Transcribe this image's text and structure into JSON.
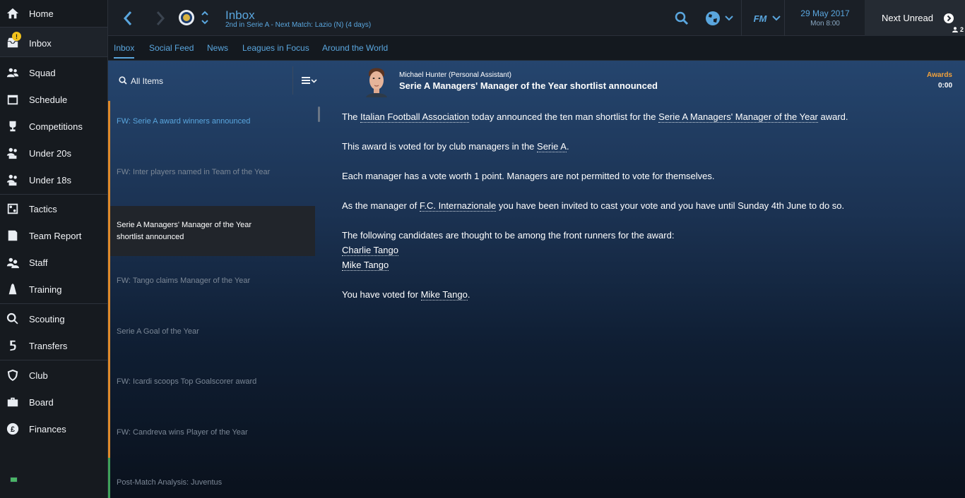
{
  "sidebar": {
    "items": [
      {
        "label": "Home",
        "icon": "home-icon"
      },
      {
        "label": "Inbox",
        "icon": "inbox-icon",
        "badge": "!"
      },
      {
        "label": "Squad",
        "icon": "squad-icon"
      },
      {
        "label": "Schedule",
        "icon": "schedule-icon"
      },
      {
        "label": "Competitions",
        "icon": "trophy-icon"
      },
      {
        "label": "Under 20s",
        "icon": "under20s-icon"
      },
      {
        "label": "Under 18s",
        "icon": "under18s-icon"
      },
      {
        "label": "Tactics",
        "icon": "tactics-icon"
      },
      {
        "label": "Team Report",
        "icon": "team-report-icon"
      },
      {
        "label": "Staff",
        "icon": "staff-icon"
      },
      {
        "label": "Training",
        "icon": "training-icon"
      },
      {
        "label": "Scouting",
        "icon": "scouting-icon"
      },
      {
        "label": "Transfers",
        "icon": "transfers-icon"
      },
      {
        "label": "Club",
        "icon": "club-shield-icon"
      },
      {
        "label": "Board",
        "icon": "briefcase-icon"
      },
      {
        "label": "Finances",
        "icon": "pound-coin-icon"
      }
    ]
  },
  "header": {
    "title": "Inbox",
    "subtitle": "2nd in Serie A - Next Match: Lazio (N) (4 days)",
    "date": "29 May 2017",
    "time": "Mon 8:00",
    "next_unread": "Next Unread",
    "next_unread_count": "2",
    "logo_text": "FM"
  },
  "tabs": [
    "Inbox",
    "Social Feed",
    "News",
    "Leagues in Focus",
    "Around the World"
  ],
  "list": {
    "filter_label": "All Items",
    "messages": [
      {
        "text": "FW: Serie A award winners announced",
        "state": "unread",
        "bar": "#e08a2a"
      },
      {
        "text": "FW: Inter players named in Team of the Year",
        "state": "read",
        "bar": "#e08a2a"
      },
      {
        "text": "Serie A Managers' Manager of the Year shortlist announced",
        "state": "selected",
        "bar": "#e08a2a"
      },
      {
        "text": "FW: Tango claims Manager of the Year",
        "state": "read",
        "bar": "#e08a2a"
      },
      {
        "text": "Serie A Goal of the Year",
        "state": "read",
        "bar": "#e08a2a"
      },
      {
        "text": "FW: Icardi scoops Top Goalscorer award",
        "state": "read",
        "bar": "#e08a2a"
      },
      {
        "text": "FW: Candreva wins Player of the Year",
        "state": "read",
        "bar": "#e08a2a"
      },
      {
        "text": "Post-Match Analysis: Juventus",
        "state": "read",
        "bar": "#3fa25a"
      }
    ]
  },
  "message": {
    "sender": "Michael Hunter  (Personal Assistant)",
    "subject": "Serie A Managers' Manager of the Year shortlist announced",
    "category": "Awards",
    "time": "0:00",
    "p1_a": "The ",
    "p1_link1": "Italian Football Association",
    "p1_b": " today announced the ten man shortlist for the ",
    "p1_link2": "Serie A Managers' Manager of the Year",
    "p1_c": " award.",
    "p2_a": "This award is voted for by club managers in the ",
    "p2_link": "Serie A",
    "p2_b": ".",
    "p3": "Each manager has a vote worth 1 point. Managers are not permitted to vote for themselves.",
    "p4_a": "As the manager of ",
    "p4_link": "F.C. Internazionale",
    "p4_b": " you have been invited to cast your vote and you have until Sunday 4th June to do so.",
    "p5": "The following candidates are thought to be among the front runners for the award:",
    "candidate1": "Charlie Tango",
    "candidate2": "Mike Tango",
    "p6_a": "You have voted for ",
    "p6_link": "Mike Tango",
    "p6_b": "."
  },
  "colors": {
    "accent": "#5aa6de",
    "awards": "#f2a23b",
    "badge": "#f2c21b"
  }
}
